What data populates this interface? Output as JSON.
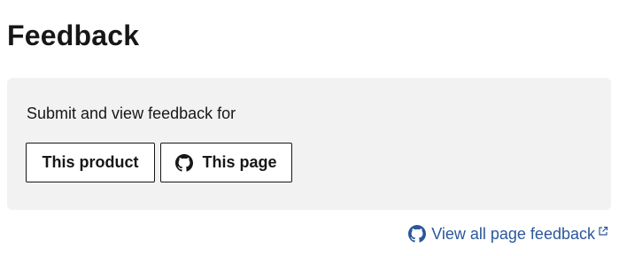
{
  "page": {
    "title": "Feedback"
  },
  "feedback_panel": {
    "prompt": "Submit and view feedback for",
    "product_button_label": "This product",
    "page_button_label": "This page",
    "page_button_icon": "github-icon"
  },
  "footer_link": {
    "label": "View all page feedback",
    "leading_icon": "github-icon",
    "trailing_icon": "external-link-icon"
  },
  "colors": {
    "panel_background": "#f2f2f2",
    "link": "#2b579a",
    "text": "#171717",
    "button_border": "#171717"
  }
}
